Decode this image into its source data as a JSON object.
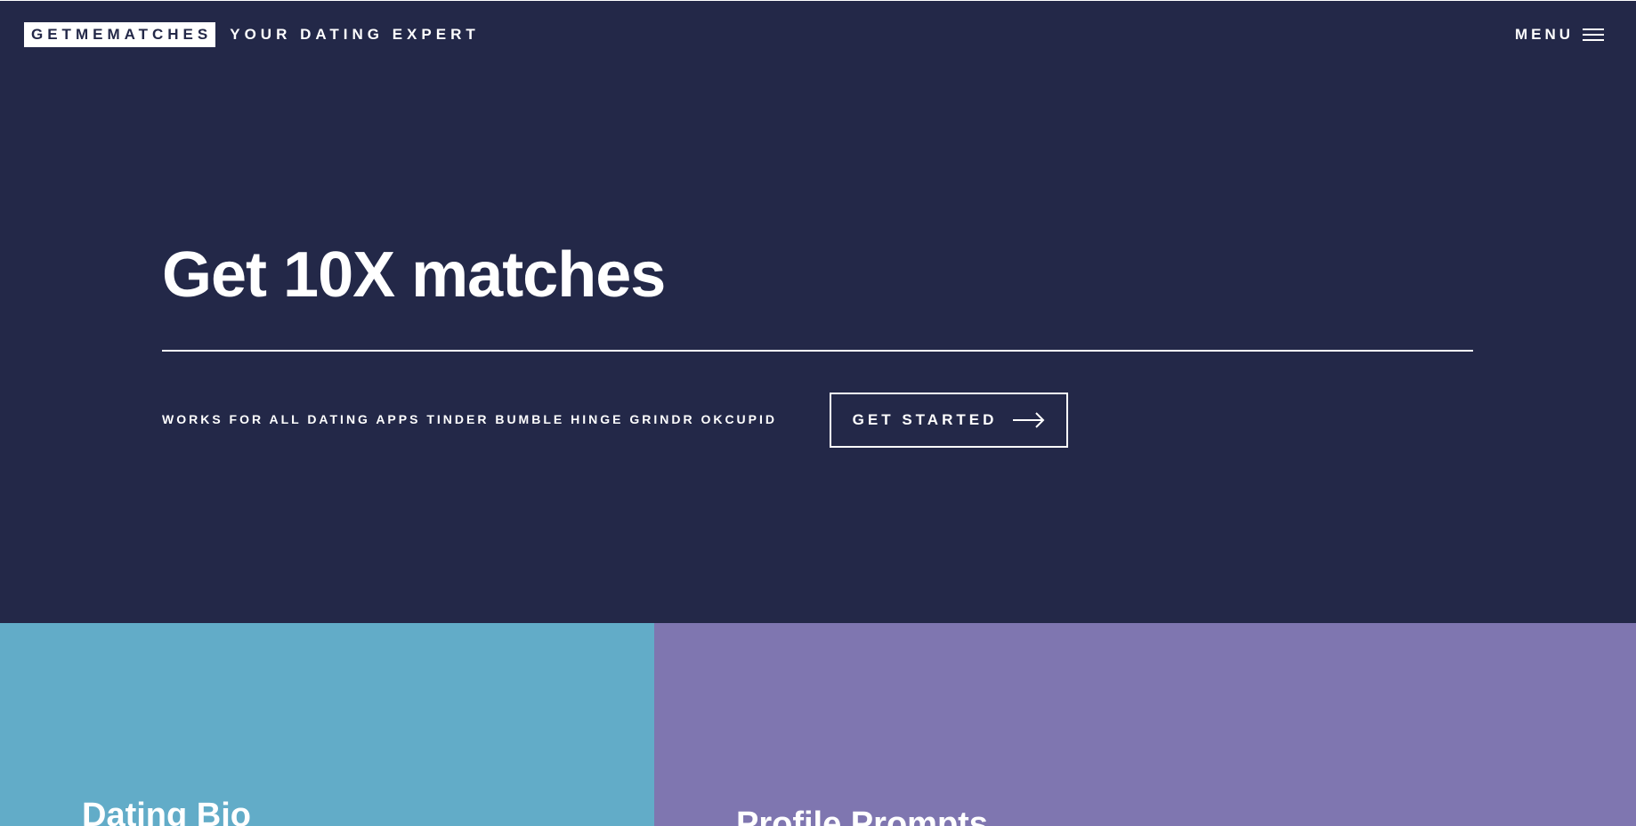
{
  "header": {
    "logo": "GETMEMATCHES",
    "tagline": "YOUR DATING EXPERT",
    "menu_label": "MENU",
    "menu_icon": "hamburger-icon"
  },
  "hero": {
    "headline": "Get 10X matches",
    "apps_line": "WORKS FOR ALL DATING APPS TINDER BUMBLE HINGE GRINDR OKCUPID",
    "cta_label": "GET STARTED",
    "cta_icon": "arrow-right-icon"
  },
  "cards": [
    {
      "title": "Dating Bio",
      "color": "#62acc8"
    },
    {
      "title": "Profile Prompts",
      "color": "#7f76b0"
    }
  ],
  "colors": {
    "hero_background": "#232848",
    "text": "#ffffff"
  }
}
